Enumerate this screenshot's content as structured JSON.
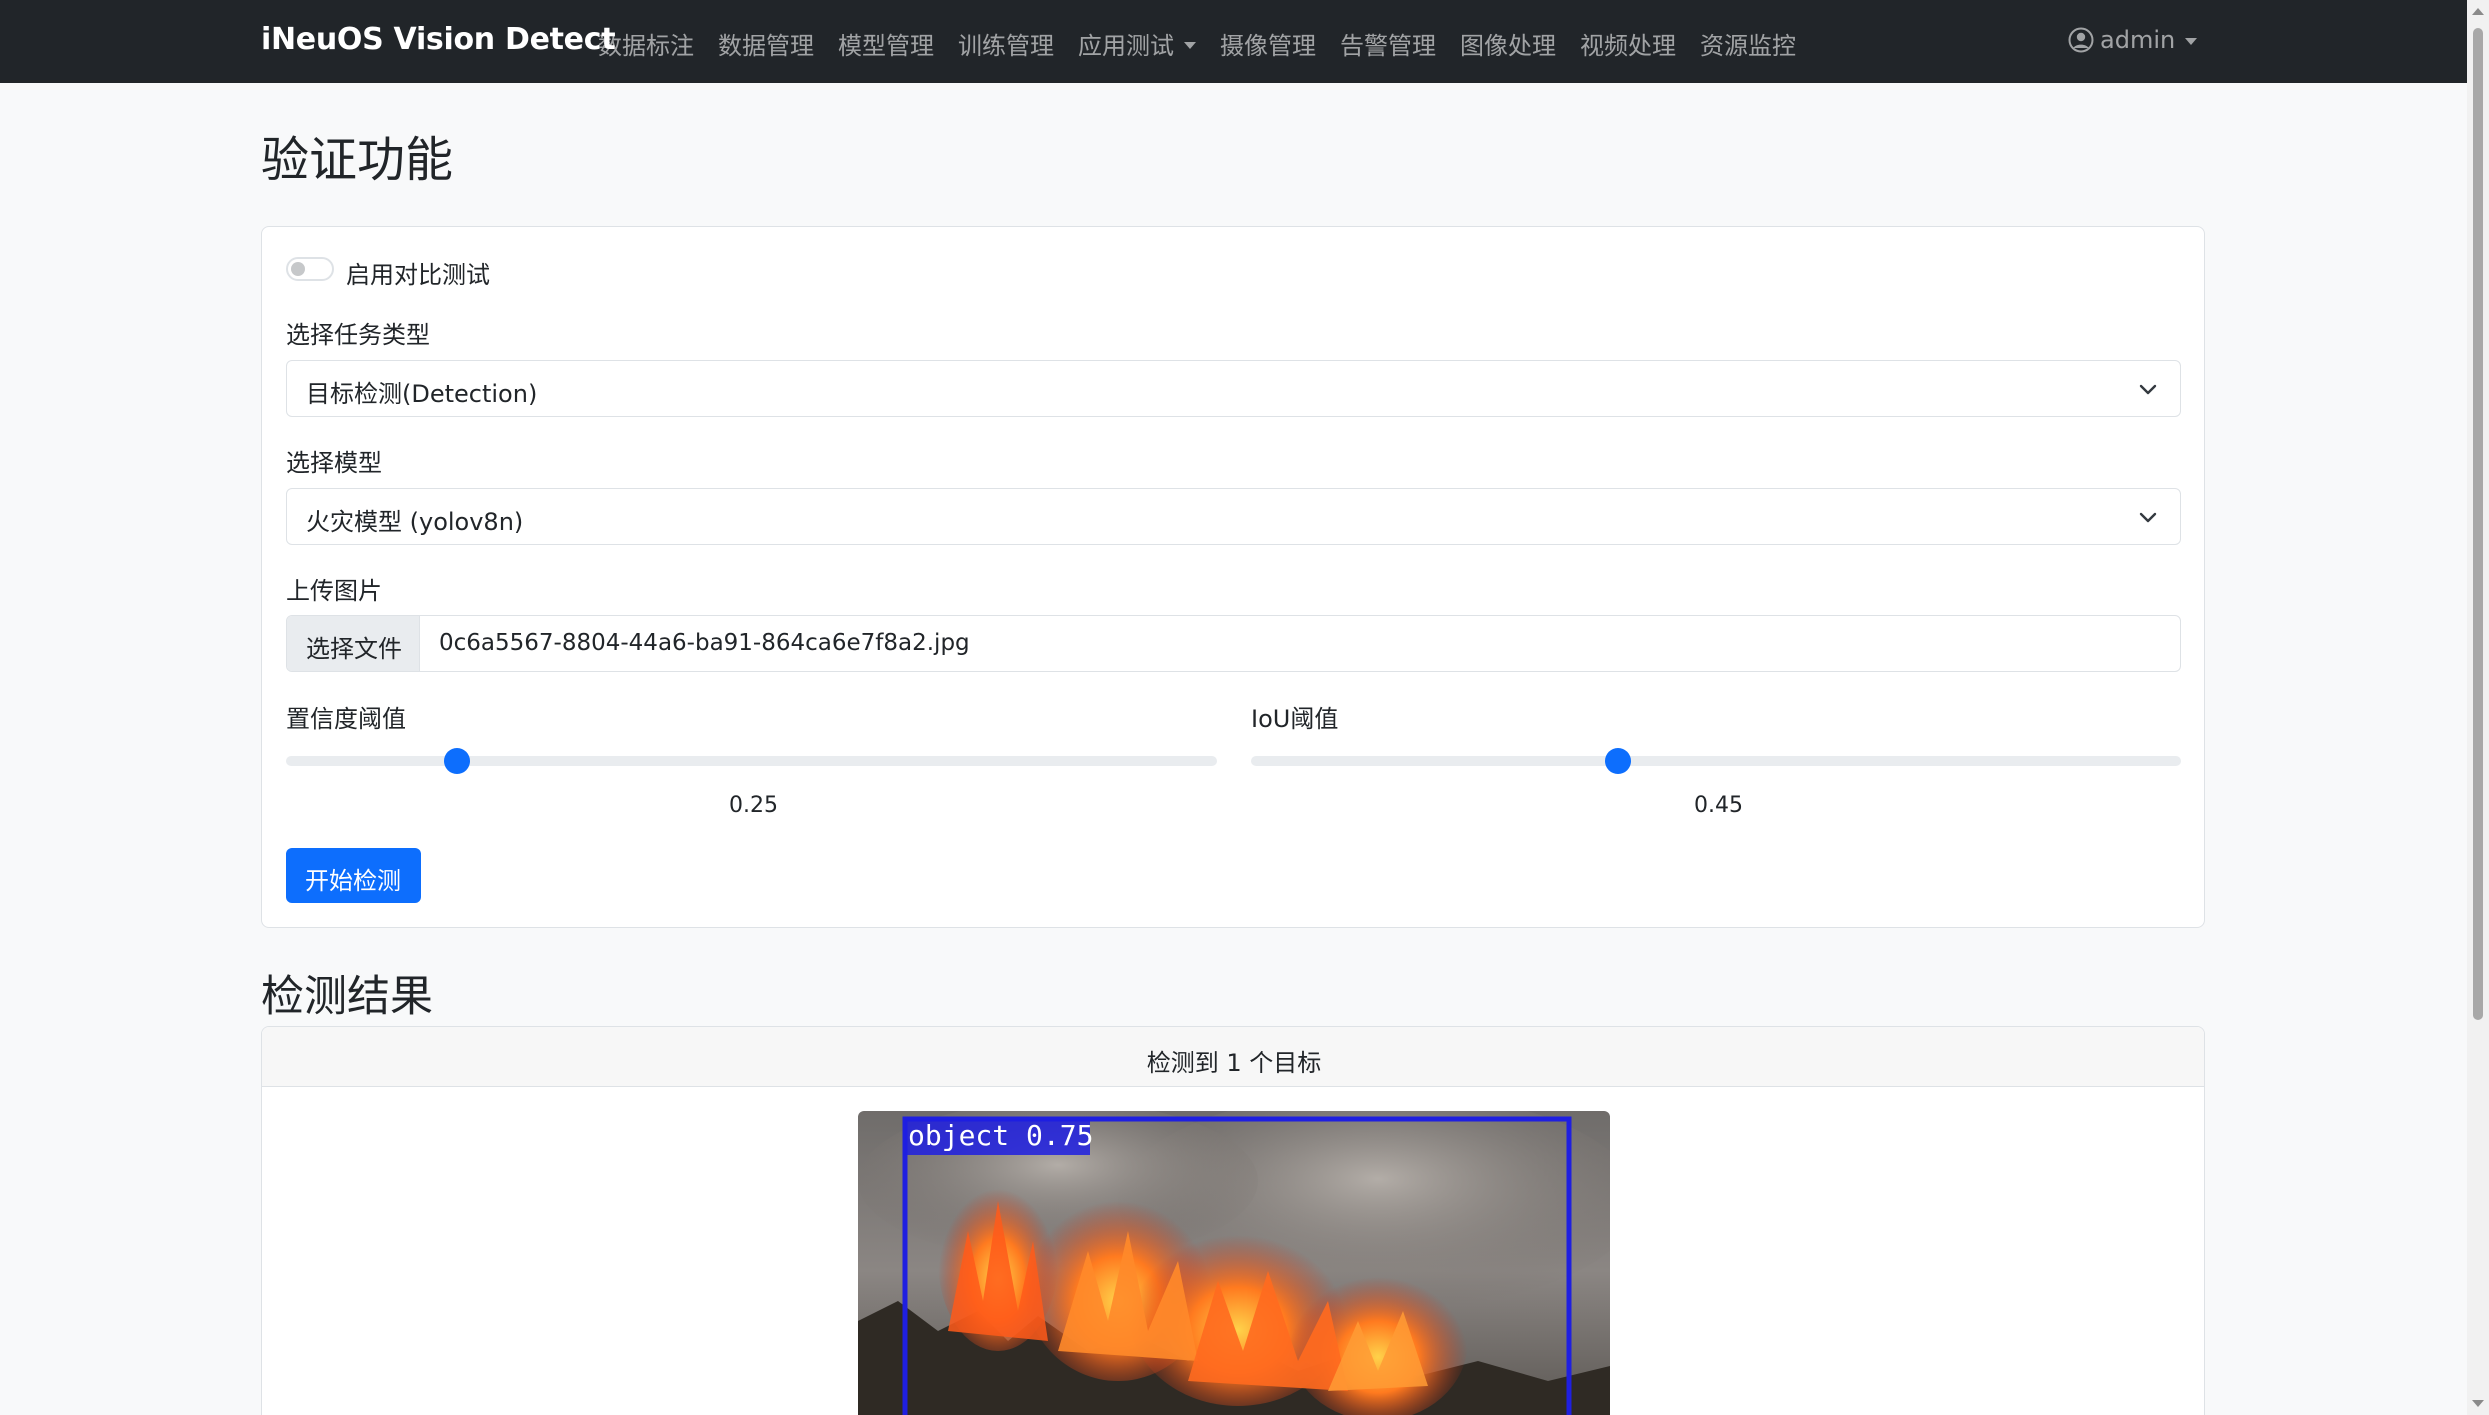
{
  "navbar": {
    "brand": "iNeuOS Vision Detect",
    "items": [
      {
        "label": "数据标注"
      },
      {
        "label": "数据管理"
      },
      {
        "label": "模型管理"
      },
      {
        "label": "训练管理"
      },
      {
        "label": "应用测试",
        "dropdown": true
      },
      {
        "label": "摄像管理"
      },
      {
        "label": "告警管理"
      },
      {
        "label": "图像处理"
      },
      {
        "label": "视频处理"
      },
      {
        "label": "资源监控"
      }
    ],
    "user": "admin"
  },
  "page": {
    "title": "验证功能"
  },
  "form": {
    "compare_toggle": {
      "label": "启用对比测试",
      "checked": false
    },
    "task_type": {
      "label": "选择任务类型",
      "value": "目标检测(Detection)"
    },
    "model": {
      "label": "选择模型",
      "value": "火灾模型 (yolov8n)"
    },
    "upload": {
      "label": "上传图片",
      "button": "选择文件",
      "file_name": "0c6a5567-8804-44a6-ba91-864ca6e7f8a2.jpg"
    },
    "confidence": {
      "label": "置信度阈值",
      "value": "0.25",
      "fraction": 0.25
    },
    "iou": {
      "label": "IoU阈值",
      "value": "0.45",
      "fraction": 0.45
    },
    "submit_label": "开始检测"
  },
  "results": {
    "title": "检测结果",
    "summary": "检测到 1 个目标",
    "detection_label": "object 0.75"
  },
  "colors": {
    "navbar_bg": "#212529",
    "primary": "#0d6efd",
    "bbox": "#1f1fe0"
  }
}
